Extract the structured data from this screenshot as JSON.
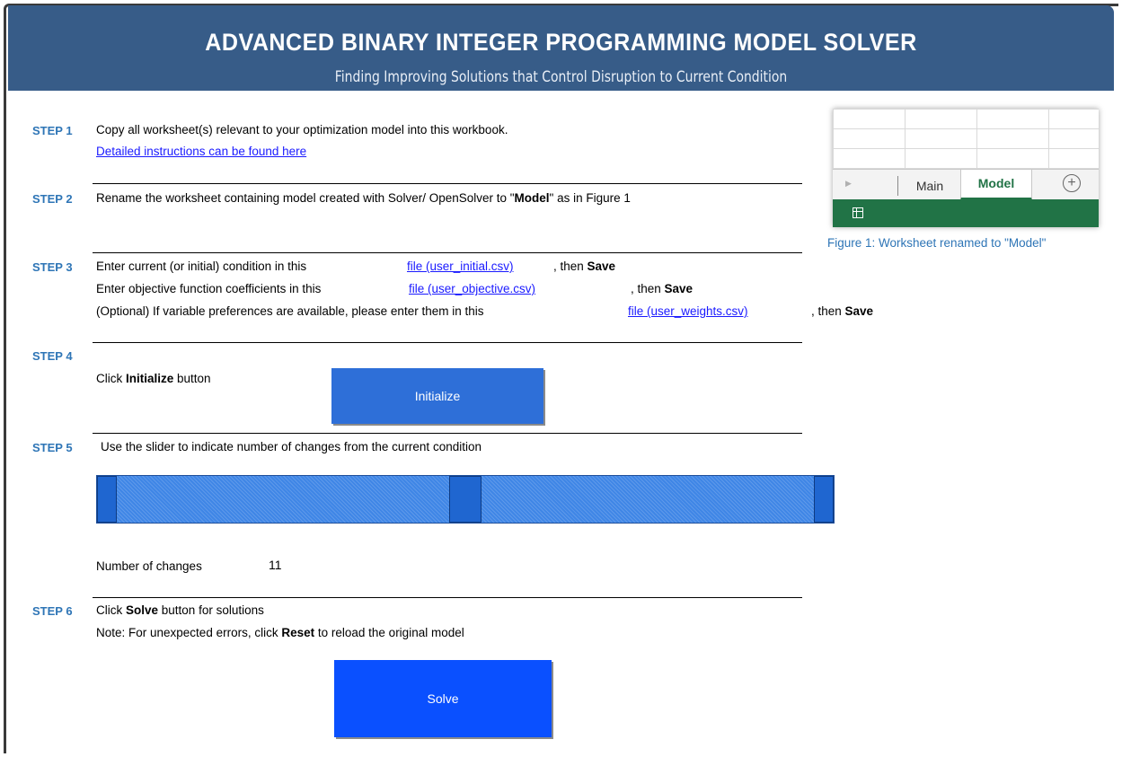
{
  "header": {
    "title": "ADVANCED BINARY INTEGER PROGRAMMING MODEL SOLVER",
    "subtitle": "Finding Improving Solutions that Control Disruption to Current Condition"
  },
  "step1": {
    "label": "STEP 1",
    "text": "Copy all worksheet(s) relevant to your optimization model into this workbook.",
    "link": "Detailed instructions can be found here"
  },
  "step2": {
    "label": "STEP 2",
    "text_before": "Rename the worksheet containing model created with Solver/ OpenSolver to \"",
    "bold": "Model",
    "text_after": "\" as in Figure 1"
  },
  "step3": {
    "label": "STEP 3",
    "line1_text": "Enter current (or initial) condition in this",
    "line1_link": "file (user_initial.csv)",
    "line1_suffix": ", then ",
    "line2_text": "Enter objective function coefficients in this",
    "line2_link": "file (user_objective.csv)",
    "line2_suffix": ", then ",
    "line3_text": "(Optional) If variable preferences are available, please enter them in this",
    "line3_link": "file (user_weights.csv)",
    "line3_suffix": ", then ",
    "save": "Save"
  },
  "step4": {
    "label": "STEP 4",
    "text_before": "Click ",
    "bold": "Initialize",
    "text_after": " button",
    "button": "Initialize"
  },
  "step5": {
    "label": "STEP 5",
    "text": "Use the slider to indicate number of changes from the current condition",
    "slider_position": 0.5,
    "changes_label": "Number of changes",
    "changes_value": "11"
  },
  "step6": {
    "label": "STEP 6",
    "line1_before": "Click ",
    "line1_bold": "Solve",
    "line1_after": " button for solutions",
    "line2_before": "Note: For unexpected errors, click ",
    "line2_bold": "Reset",
    "line2_after": " to reload the original model",
    "button": "Solve"
  },
  "figure": {
    "tab_main": "Main",
    "tab_model": "Model",
    "caption": "Figure 1: Worksheet renamed to \"Model\""
  },
  "colors": {
    "header_bg": "#375c88",
    "step_label": "#2e75b6",
    "link": "#1a1aff",
    "initialize_button": "#2e6fd8",
    "solve_button": "#0a50ff",
    "excel_green": "#217346"
  }
}
